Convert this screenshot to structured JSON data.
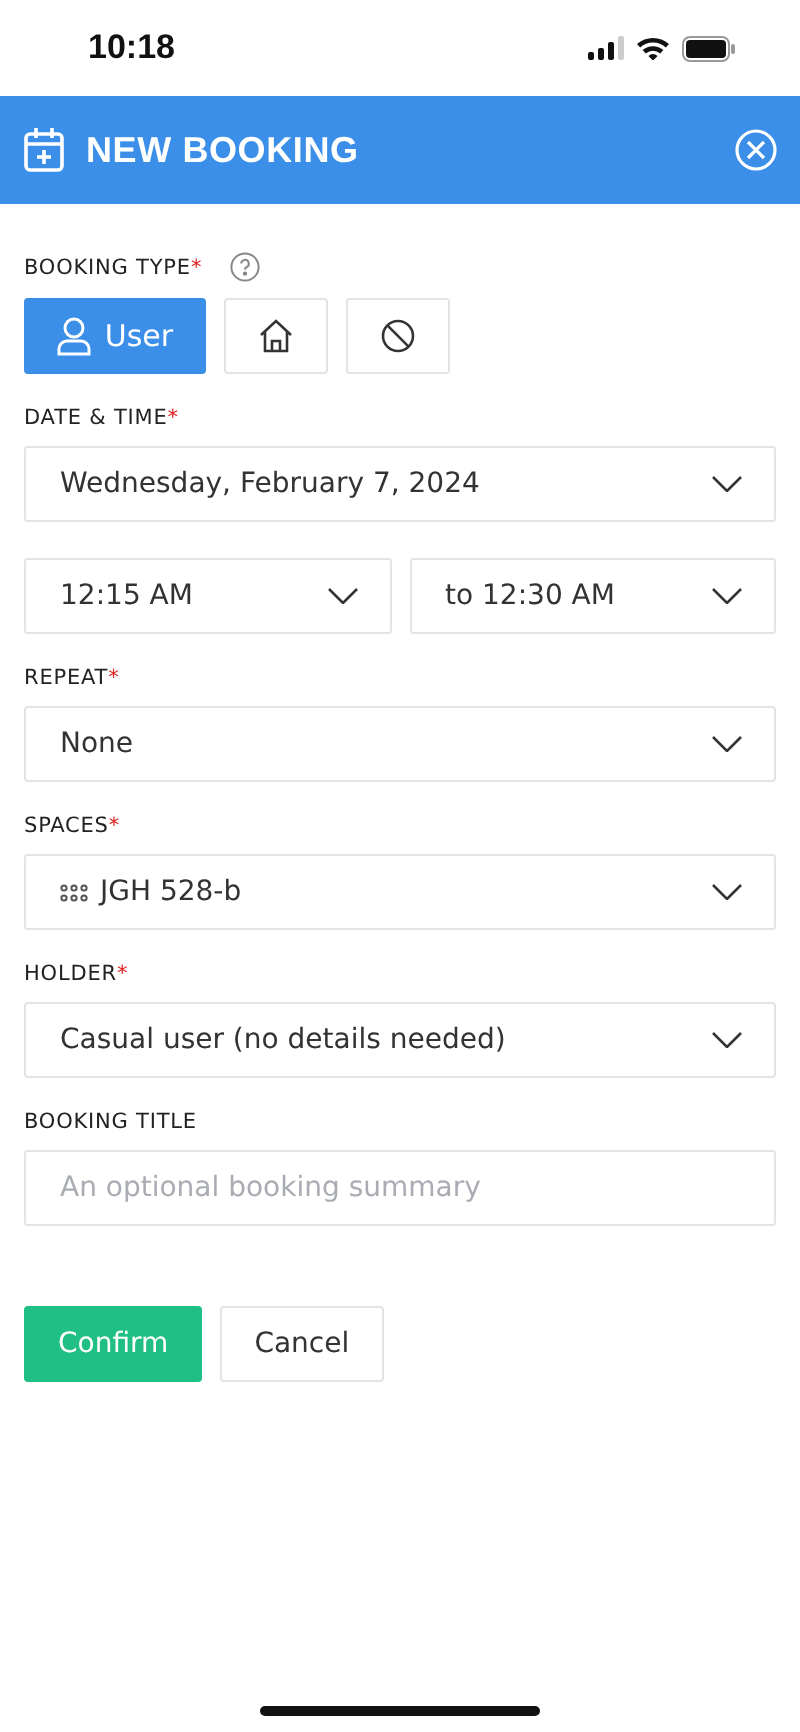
{
  "status_bar": {
    "time": "10:18"
  },
  "header": {
    "title": "NEW BOOKING"
  },
  "booking_type": {
    "label": "BOOKING TYPE",
    "required_mark": "*",
    "options": [
      {
        "kind": "user",
        "label": "User",
        "selected": true
      },
      {
        "kind": "home",
        "selected": false
      },
      {
        "kind": "block",
        "selected": false
      }
    ]
  },
  "sections": [
    {
      "label": "DATE & TIME",
      "required_mark": "*",
      "rows": [
        [
          {
            "kind": "select",
            "value": "Wednesday, February 7, 2024"
          }
        ],
        [
          {
            "kind": "select",
            "value": "12:15 AM"
          },
          {
            "kind": "select",
            "value": "to 12:30 AM"
          }
        ]
      ]
    },
    {
      "label": "REPEAT",
      "required_mark": "*",
      "rows": [
        [
          {
            "kind": "select",
            "value": "None"
          }
        ]
      ]
    },
    {
      "label": "SPACES",
      "required_mark": "*",
      "rows": [
        [
          {
            "kind": "space-select",
            "value": "JGH 528-b"
          }
        ]
      ]
    },
    {
      "label": "HOLDER",
      "required_mark": "*",
      "rows": [
        [
          {
            "kind": "select",
            "value": "Casual user (no details needed)"
          }
        ]
      ]
    },
    {
      "label": "BOOKING TITLE",
      "rows": [
        [
          {
            "kind": "text",
            "placeholder": "An optional booking summary"
          }
        ]
      ]
    }
  ],
  "actions": [
    {
      "kind": "primary",
      "label": "Confirm"
    },
    {
      "kind": "secondary",
      "label": "Cancel"
    }
  ]
}
